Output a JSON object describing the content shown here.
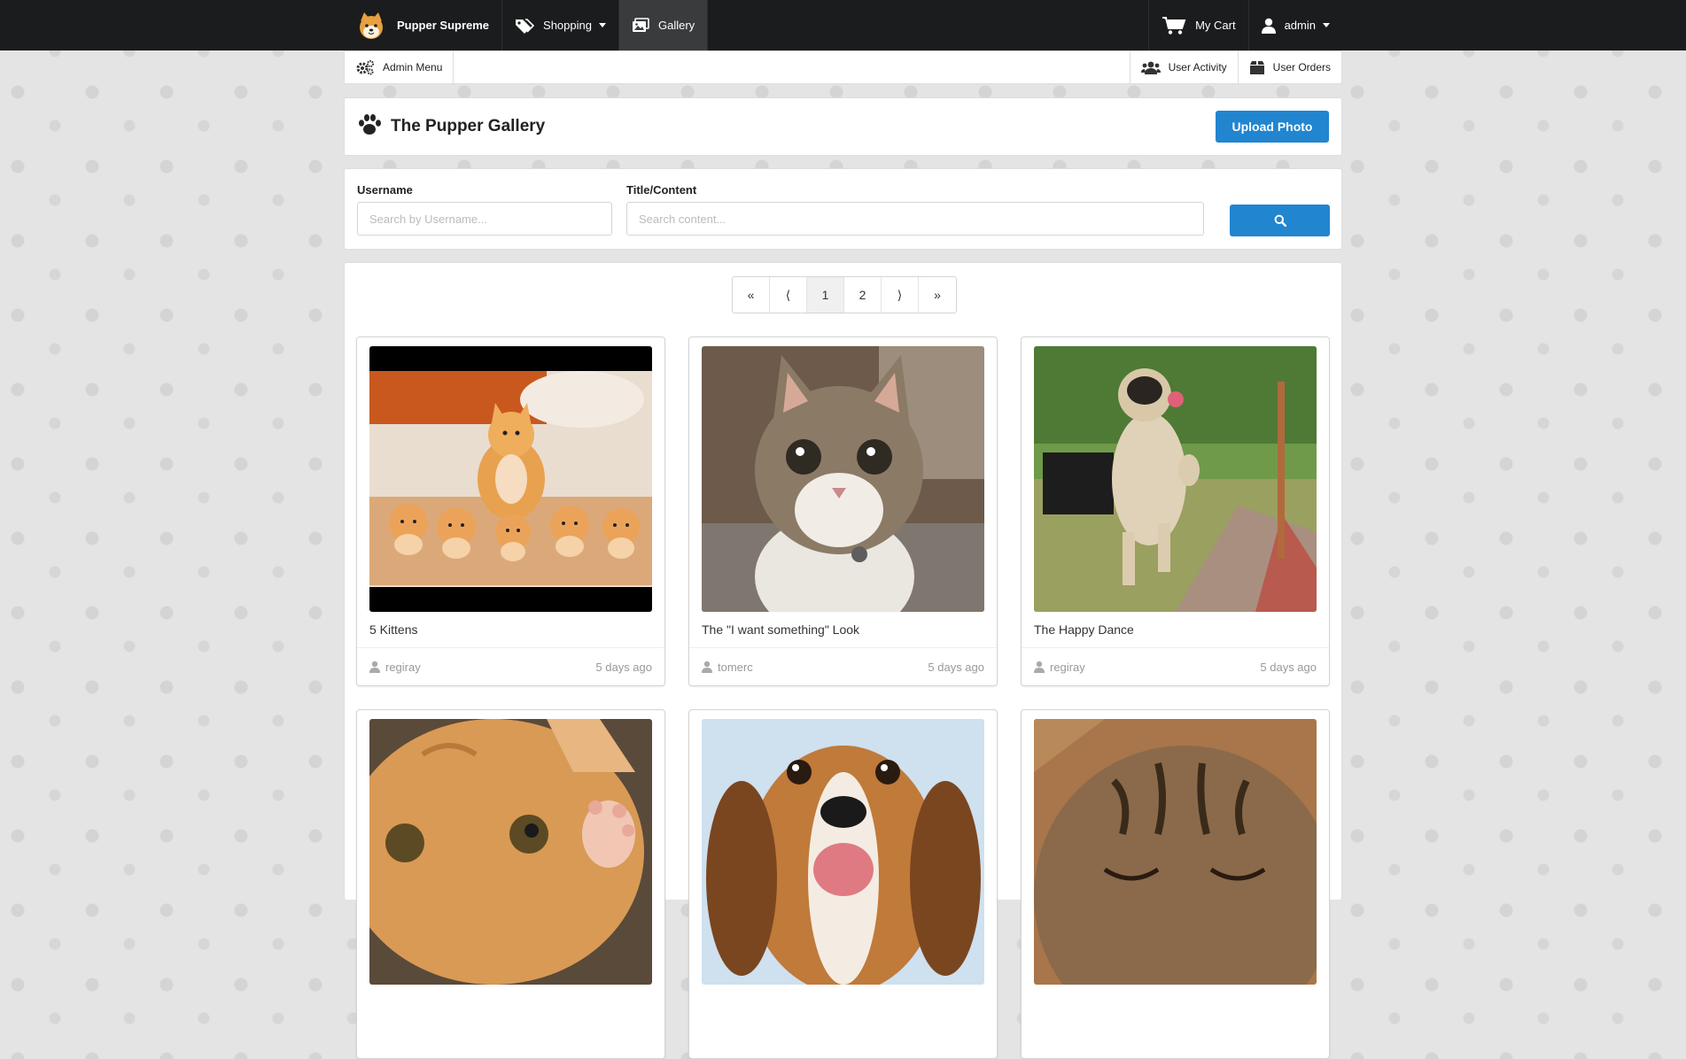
{
  "brand": {
    "name": "Pupper Supreme",
    "logo": "shiba-dog-logo"
  },
  "nav": {
    "shopping_label": "Shopping",
    "gallery_label": "Gallery",
    "cart_label": "My Cart",
    "user_label": "admin"
  },
  "subnav": {
    "admin_menu_label": "Admin Menu",
    "user_activity_label": "User Activity",
    "user_orders_label": "User Orders"
  },
  "header": {
    "title": "The Pupper Gallery",
    "upload_label": "Upload Photo"
  },
  "search": {
    "username_label": "Username",
    "username_placeholder": "Search by Username...",
    "content_label": "Title/Content",
    "content_placeholder": "Search content..."
  },
  "pagination": {
    "first": "«",
    "prev": "⟨",
    "pages": [
      "1",
      "2"
    ],
    "current": "1",
    "next": "⟩",
    "last": "»"
  },
  "posts": [
    {
      "title": "5 Kittens",
      "user": "regiray",
      "time": "5 days ago",
      "image": "kittens-photo"
    },
    {
      "title": "The \"I want something\" Look",
      "user": "tomerc",
      "time": "5 days ago",
      "image": "tabby-cat-photo"
    },
    {
      "title": "The Happy Dance",
      "user": "regiray",
      "time": "5 days ago",
      "image": "dancing-pug-photo"
    },
    {
      "title": "",
      "user": "",
      "time": "",
      "image": "orange-kitten-photo"
    },
    {
      "title": "",
      "user": "",
      "time": "",
      "image": "beagle-puppy-photo"
    },
    {
      "title": "",
      "user": "",
      "time": "",
      "image": "sleepy-tabby-photo"
    }
  ],
  "colors": {
    "topbar": "#1b1c1d",
    "primary": "#2185d0",
    "background": "#e4e4e4"
  }
}
